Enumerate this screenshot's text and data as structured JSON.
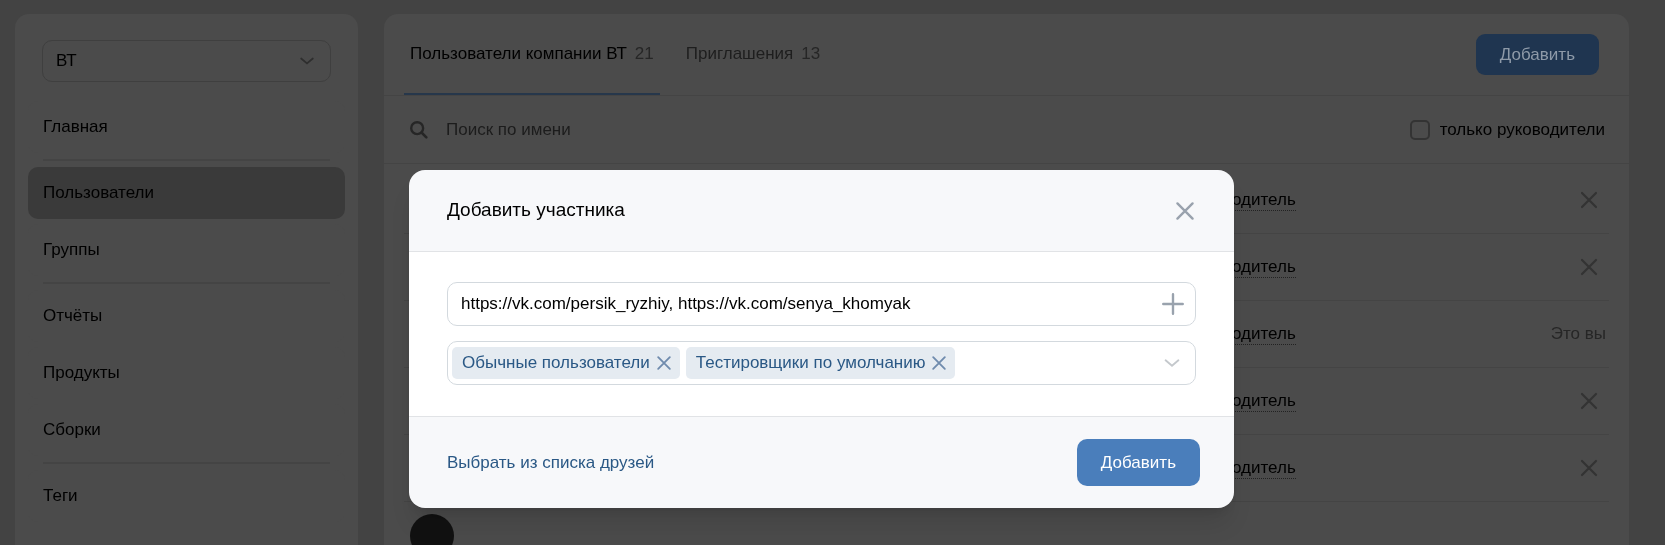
{
  "sidebar": {
    "org_select": {
      "value": "ВТ"
    },
    "items": [
      {
        "label": "Главная",
        "selected": false
      },
      {
        "label": "Пользователи",
        "selected": true
      },
      {
        "label": "Группы",
        "selected": false
      },
      {
        "label": "Отчёты",
        "selected": false
      },
      {
        "label": "Продукты",
        "selected": false
      },
      {
        "label": "Сборки",
        "selected": false
      },
      {
        "label": "Теги",
        "selected": false
      }
    ]
  },
  "main": {
    "tabs": [
      {
        "label": "Пользователи компании ВТ",
        "count": "21",
        "selected": true
      },
      {
        "label": "Приглашения",
        "count": "13",
        "selected": false
      }
    ],
    "add_button": "Добавить",
    "search": {
      "placeholder": "Поиск по имени"
    },
    "filter": {
      "label": "только руководители",
      "checked": false
    },
    "rows": [
      {
        "kind": "member",
        "role": "одитель",
        "removable": true
      },
      {
        "kind": "member",
        "role": "одитель",
        "removable": true
      },
      {
        "kind": "member",
        "role": "одитель",
        "removable": false,
        "note": "Это вы"
      },
      {
        "kind": "member",
        "role": "одитель",
        "removable": true
      },
      {
        "kind": "member",
        "role": "одитель",
        "removable": true
      },
      {
        "kind": "cut"
      }
    ]
  },
  "dialog": {
    "title": "Добавить участника",
    "links_field": {
      "value": "https://vk.com/persik_ryzhiy, https://vk.com/senya_khomyak"
    },
    "groups": [
      {
        "label": "Обычные пользователи"
      },
      {
        "label": "Тестировщики по умолчанию"
      }
    ],
    "friends_link": "Выбрать из списка друзей",
    "submit": "Добавить"
  }
}
